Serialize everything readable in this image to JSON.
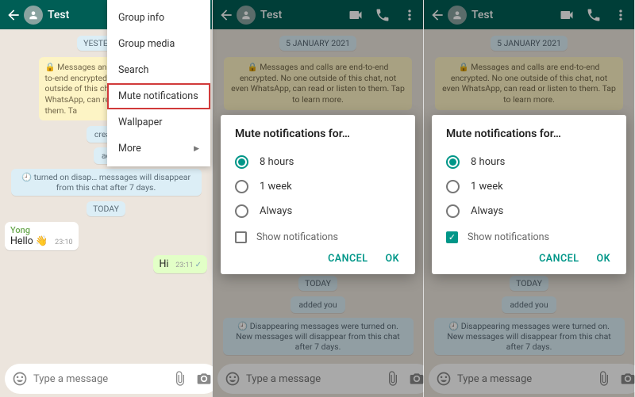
{
  "header": {
    "title": "Test"
  },
  "menu": {
    "items": [
      "Group info",
      "Group media",
      "Search",
      "Mute notifications",
      "Wallpaper",
      "More"
    ]
  },
  "chat": {
    "date1": "YESTERDAY",
    "date2": "5 JANUARY 2021",
    "encryption_full": "🔒 Messages and calls are end-to-end encrypted. No one outside of this chat, not even WhatsApp, can read or listen to them. Tap to learn more.",
    "encryption_trunc": "🔒 Messages and calls are end-to-end encrypted. No one outside of this chat, not even WhatsApp, can read or listen to them. Ta",
    "sys_created_full": "created group \"Test\"",
    "sys_created_trunc": "create",
    "sys_added_trunc": "ac",
    "sys_added_full": "added you",
    "sys_disappear_trunc": "🕘 turned on disap… messages will disappear from this chat after 7 days.",
    "sys_disappear_full": "🕘 Disappearing messages were turned on. New messages will disappear from this chat after 7 days.",
    "today": "TODAY",
    "msg_in_sender": "Yong",
    "msg_in_body": "Hello 👋",
    "msg_in_time": "23:10",
    "msg_out_body": "Hi",
    "msg_out_time": "23:11"
  },
  "input": {
    "placeholder": "Type a message"
  },
  "dialog": {
    "title": "Mute notifications for…",
    "options": [
      "8 hours",
      "1 week",
      "Always"
    ],
    "selected": "8 hours",
    "show_notifications_label": "Show notifications",
    "cancel": "CANCEL",
    "ok": "OK"
  },
  "panes": {
    "mid_show_notifications_checked": false,
    "right_show_notifications_checked": true
  }
}
